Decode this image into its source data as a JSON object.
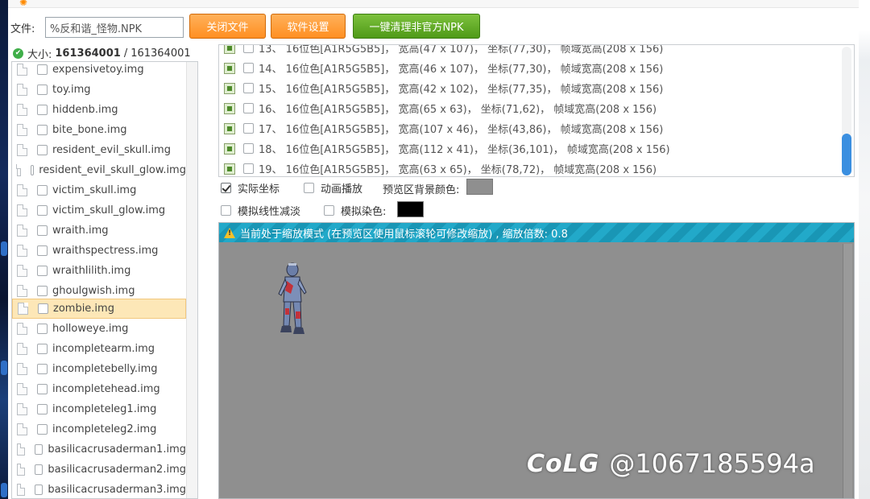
{
  "toolbar": {
    "file_label": "文件:",
    "file_value": "%反和谐_怪物.NPK",
    "close_button": "关闭文件",
    "settings_button": "软件设置",
    "clean_button": "一键清理非官方NPK"
  },
  "size": {
    "label": "大小:",
    "current": "161364001",
    "separator": "/",
    "total": "161364001"
  },
  "file_list": [
    "expensivetoy.img",
    "toy.img",
    "hiddenb.img",
    "bite_bone.img",
    "resident_evil_skull.img",
    "resident_evil_skull_glow.img",
    "victim_skull.img",
    "victim_skull_glow.img",
    "wraith.img",
    "wraithspectress.img",
    "wraithlilith.img",
    "ghoulgwish.img",
    "zombie.img",
    "holloweye.img",
    "incompletearm.img",
    "incompletebelly.img",
    "incompletehead.img",
    "incompleteleg1.img",
    "incompleteleg2.img",
    "basilicacrusaderman1.img",
    "basilicacrusaderman2.img",
    "basilicacrusaderman3.img"
  ],
  "selected_file": "zombie.img",
  "frames": [
    "13、 16位色[A1R5G5B5]， 宽高(47 x 107)， 坐标(77,30)， 帧域宽高(208 x 156)",
    "14、 16位色[A1R5G5B5]， 宽高(46 x 107)， 坐标(77,30)， 帧域宽高(208 x 156)",
    "15、 16位色[A1R5G5B5]， 宽高(42 x 102)， 坐标(77,35)， 帧域宽高(208 x 156)",
    "16、 16位色[A1R5G5B5]， 宽高(65 x 63)， 坐标(71,62)， 帧域宽高(208 x 156)",
    "17、 16位色[A1R5G5B5]， 宽高(107 x 46)， 坐标(43,86)， 帧域宽高(208 x 156)",
    "18、 16位色[A1R5G5B5]， 宽高(112 x 41)， 坐标(36,101)， 帧域宽高(208 x 156)",
    "19、 16位色[A1R5G5B5]， 宽高(63 x 65)， 坐标(78,72)， 帧域宽高(208 x 156)"
  ],
  "options": {
    "actual_coords": "实际坐标",
    "actual_coords_checked": true,
    "anim_play": "动画播放",
    "anim_play_checked": false,
    "bg_color_label": "预览区背景颜色:",
    "bg_color": "#8f8f8f",
    "linear_fade": "模拟线性减淡",
    "linear_fade_checked": false,
    "dye": "模拟染色:",
    "dye_checked": false,
    "dye_color": "#000000"
  },
  "preview": {
    "banner_text": "当前处于缩放模式 (在预览区使用鼠标滚轮可修改缩放) , 缩放倍数: 0.8"
  },
  "watermark": {
    "logo": "CoLG",
    "handle": "@1067185594a"
  }
}
